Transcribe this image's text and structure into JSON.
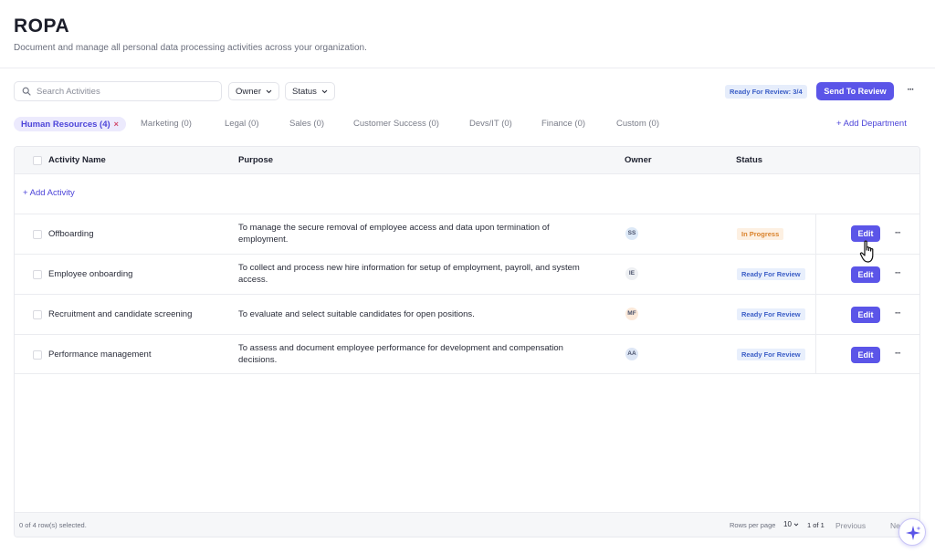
{
  "header": {
    "title": "ROPA",
    "subtitle": "Document and manage all personal data processing activities across your organization."
  },
  "toolbar": {
    "search_placeholder": "Search Activities",
    "owner_filter": "Owner",
    "status_filter": "Status",
    "review_badge": "Ready For Review: 3/4",
    "send_button": "Send To Review",
    "more": "···"
  },
  "tabs": [
    {
      "label": "Human Resources (4)",
      "active": true
    },
    {
      "label": "Marketing (0)"
    },
    {
      "label": "Legal (0)"
    },
    {
      "label": "Sales (0)"
    },
    {
      "label": "Customer Success (0)"
    },
    {
      "label": "Devs/IT (0)"
    },
    {
      "label": "Finance (0)"
    },
    {
      "label": "Custom (0)"
    }
  ],
  "add_department": "+ Add Department",
  "table": {
    "columns": [
      "Activity Name",
      "Purpose",
      "Owner",
      "Status"
    ],
    "add_activity": "+ Add Activity",
    "rows": [
      {
        "name": "Offboarding",
        "purpose": "To manage the secure removal of employee access and data upon termination of employment.",
        "owner": "SS",
        "status": "In Progress",
        "action": "Edit"
      },
      {
        "name": "Employee onboarding",
        "purpose": "To collect and process new hire information for setup of employment, payroll, and system access.",
        "owner": "IE",
        "status": "Ready For Review",
        "action": "Edit"
      },
      {
        "name": "Recruitment and candidate screening",
        "purpose": "To evaluate and select suitable candidates for open positions.",
        "owner": "MF",
        "status": "Ready For Review",
        "action": "Edit"
      },
      {
        "name": "Performance management",
        "purpose": "To assess and document employee performance for development and compensation decisions.",
        "owner": "AA",
        "status": "Ready For Review",
        "action": "Edit"
      }
    ]
  },
  "footer": {
    "selected": "0 of 4 row(s) selected.",
    "rows_per_page_label": "Rows per page",
    "rows_per_page_value": "10",
    "page_of": "1 of 1",
    "previous": "Previous",
    "next": "Ne"
  },
  "colors": {
    "accent": "#5b55e8",
    "status_review": "#3c5fc7",
    "status_progress": "#d9822b"
  }
}
